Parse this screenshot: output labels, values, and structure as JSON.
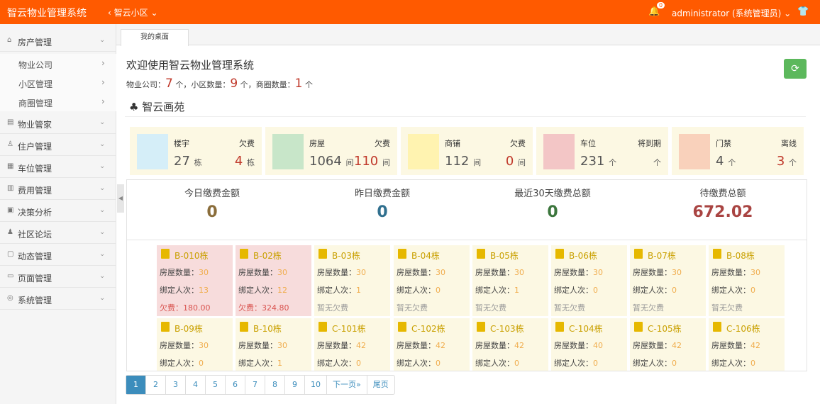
{
  "header": {
    "app_title": "智云物业管理系统",
    "community": "智云小区",
    "notif_count": "0",
    "user": "administrator (系统管理员)"
  },
  "sidebar": {
    "items": [
      {
        "label": "房产管理",
        "icon": "home-icon"
      },
      {
        "label": "物业管家",
        "icon": "file-icon"
      },
      {
        "label": "住户管理",
        "icon": "users-icon"
      },
      {
        "label": "车位管理",
        "icon": "parking-icon"
      },
      {
        "label": "费用管理",
        "icon": "money-icon"
      },
      {
        "label": "决策分析",
        "icon": "chart-icon"
      },
      {
        "label": "社区论坛",
        "icon": "forum-icon"
      },
      {
        "label": "动态管理",
        "icon": "news-icon"
      },
      {
        "label": "页面管理",
        "icon": "page-icon"
      },
      {
        "label": "系统管理",
        "icon": "settings-icon"
      }
    ],
    "subitems": [
      "物业公司",
      "小区管理",
      "商圈管理"
    ]
  },
  "tab": {
    "label": "我的桌面"
  },
  "welcome": "欢迎使用智云物业管理系统",
  "summary": {
    "company_label": "物业公司：",
    "company": "7",
    "unit": "个",
    "community_label": "，小区数量：",
    "community": "9",
    "district_label": "，商圈数量：",
    "district": "1"
  },
  "section_title": "智云画苑",
  "stat_cards": [
    {
      "label": "楼宇",
      "value": "27",
      "unit": "栋",
      "label2": "欠费",
      "value2": "4",
      "unit2": "栋",
      "color": "#d5eef8",
      "icon": "building-icon"
    },
    {
      "label": "房屋",
      "value": "1064",
      "unit": "间",
      "label2": "欠费",
      "value2": "110",
      "unit2": "间",
      "color": "#c8e6c9",
      "icon": "house-icon"
    },
    {
      "label": "商铺",
      "value": "112",
      "unit": "间",
      "label2": "欠费",
      "value2": "0",
      "unit2": "间",
      "color": "#fff3b0",
      "icon": "cart-icon"
    },
    {
      "label": "车位",
      "value": "231",
      "unit": "个",
      "label2": "将到期",
      "value2": "",
      "unit2": "个",
      "color": "#f3c6c6",
      "icon": "car-icon"
    },
    {
      "label": "门禁",
      "value": "4",
      "unit": "个",
      "label2": "离线",
      "value2": "3",
      "unit2": "个",
      "color": "#f9d1bb",
      "icon": "door-icon"
    }
  ],
  "payments": [
    {
      "label": "今日缴费金额",
      "value": "0",
      "color": "#8a6d3b"
    },
    {
      "label": "昨日缴费金额",
      "value": "0",
      "color": "#31708f"
    },
    {
      "label": "最近30天缴费总额",
      "value": "0",
      "color": "#3c763d"
    },
    {
      "label": "待缴费总额",
      "value": "672.02",
      "color": "#a94442"
    }
  ],
  "buildings_row1": [
    {
      "name": "B-010栋",
      "rooms": "30",
      "bound": "13",
      "fee": "欠费：180.00",
      "debt": true
    },
    {
      "name": "B-02栋",
      "rooms": "30",
      "bound": "12",
      "fee": "欠费：324.80",
      "debt": true
    },
    {
      "name": "B-03栋",
      "rooms": "30",
      "bound": "1",
      "fee": "暂无欠费",
      "debt": false
    },
    {
      "name": "B-04栋",
      "rooms": "30",
      "bound": "0",
      "fee": "暂无欠费",
      "debt": false
    },
    {
      "name": "B-05栋",
      "rooms": "30",
      "bound": "1",
      "fee": "暂无欠费",
      "debt": false
    },
    {
      "name": "B-06栋",
      "rooms": "30",
      "bound": "0",
      "fee": "暂无欠费",
      "debt": false
    },
    {
      "name": "B-07栋",
      "rooms": "30",
      "bound": "0",
      "fee": "暂无欠费",
      "debt": false
    },
    {
      "name": "B-08栋",
      "rooms": "30",
      "bound": "0",
      "fee": "暂无欠费",
      "debt": false
    }
  ],
  "buildings_row2": [
    {
      "name": "B-09栋",
      "rooms": "30",
      "bound": "0"
    },
    {
      "name": "B-10栋",
      "rooms": "30",
      "bound": "1"
    },
    {
      "name": "C-101栋",
      "rooms": "42",
      "bound": "0"
    },
    {
      "name": "C-102栋",
      "rooms": "42",
      "bound": "0"
    },
    {
      "name": "C-103栋",
      "rooms": "42",
      "bound": "0"
    },
    {
      "name": "C-104栋",
      "rooms": "40",
      "bound": "0"
    },
    {
      "name": "C-105栋",
      "rooms": "42",
      "bound": "0"
    },
    {
      "name": "C-106栋",
      "rooms": "42",
      "bound": "0"
    }
  ],
  "labels": {
    "rooms": "房屋数量：",
    "bound": "绑定人次："
  },
  "pager": [
    "1",
    "2",
    "3",
    "4",
    "5",
    "6",
    "7",
    "8",
    "9",
    "10",
    "下一页»",
    "尾页"
  ]
}
